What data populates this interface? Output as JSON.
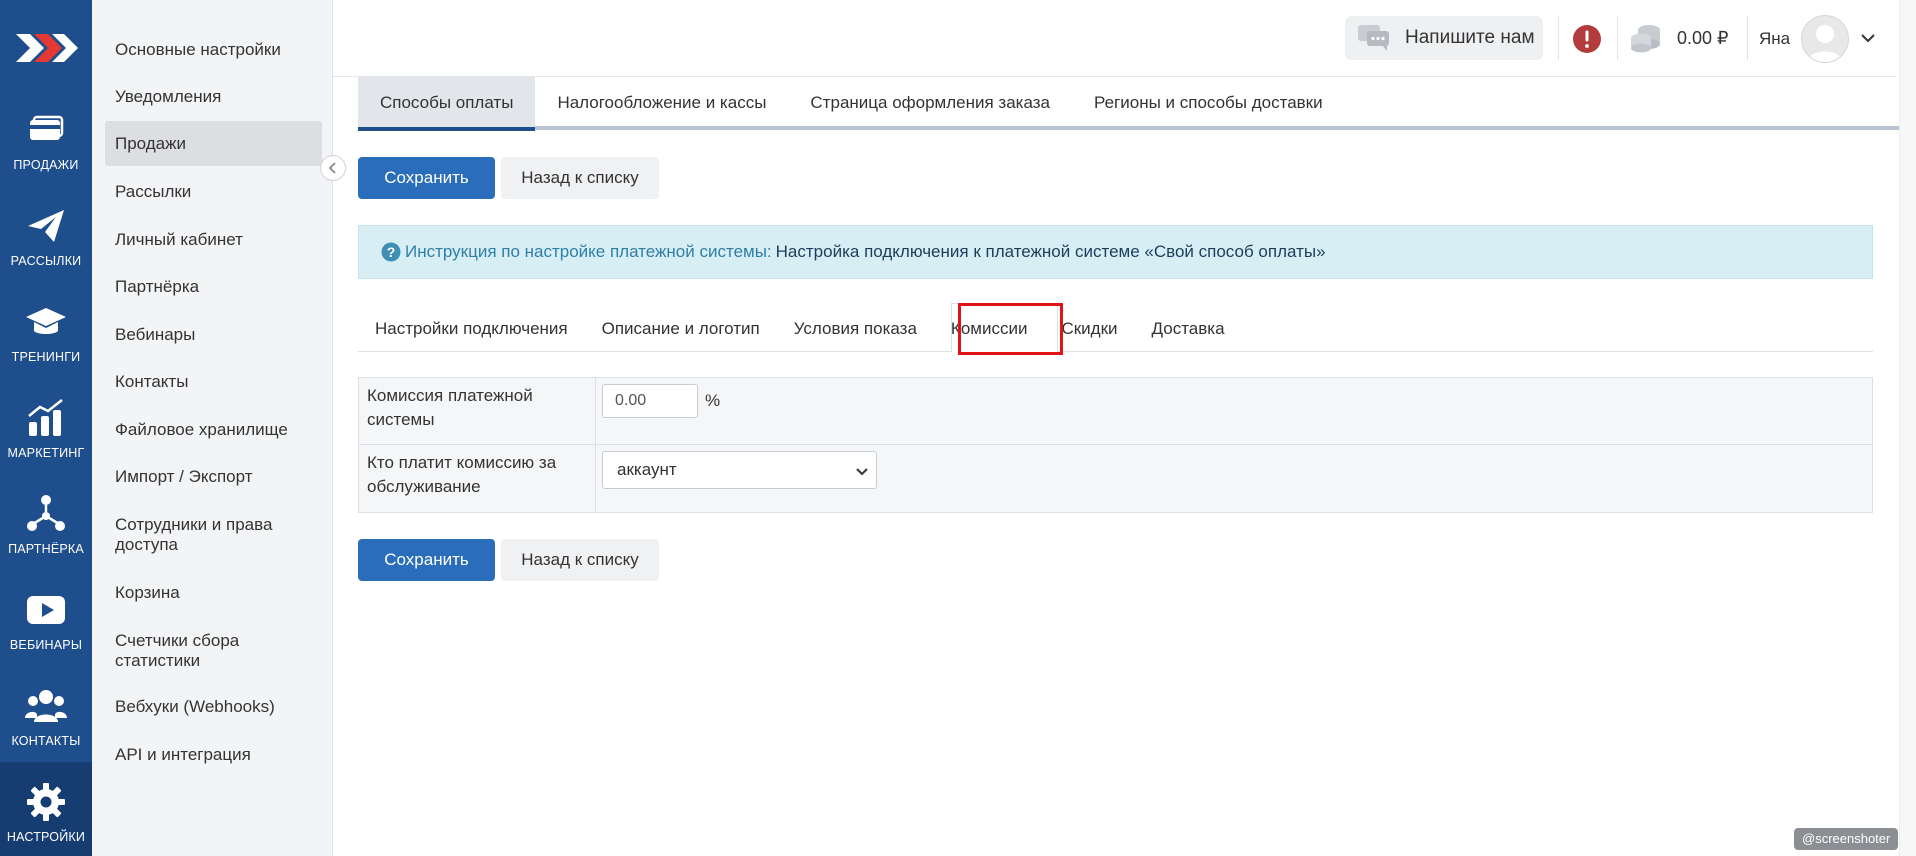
{
  "rail": {
    "items": [
      {
        "label": "Продажи",
        "icon": "card-icon"
      },
      {
        "label": "Рассылки",
        "icon": "paper-plane-icon"
      },
      {
        "label": "Тренинги",
        "icon": "graduation-cap-icon"
      },
      {
        "label": "Маркетинг",
        "icon": "chart-icon"
      },
      {
        "label": "Партнёрка",
        "icon": "network-icon"
      },
      {
        "label": "Вебинары",
        "icon": "play-icon"
      },
      {
        "label": "Контакты",
        "icon": "users-icon"
      },
      {
        "label": "Настройки",
        "icon": "gear-icon"
      }
    ]
  },
  "menu": {
    "items": [
      {
        "label": "Основные настройки"
      },
      {
        "label": "Уведомления"
      },
      {
        "label": "Продажи"
      },
      {
        "label": "Рассылки"
      },
      {
        "label": "Личный кабинет"
      },
      {
        "label": "Партнёрка"
      },
      {
        "label": "Вебинары"
      },
      {
        "label": "Контакты"
      },
      {
        "label": "Файловое хранилище"
      },
      {
        "label": "Импорт / Экспорт"
      },
      {
        "label": "Сотрудники и права доступа"
      },
      {
        "label": "Корзина"
      },
      {
        "label": "Счетчики сбора статистики"
      },
      {
        "label": "Вебхуки (Webhooks)"
      },
      {
        "label": "API и интеграция"
      }
    ]
  },
  "header": {
    "write_us": "Напишите нам",
    "balance": "0.00 ₽",
    "username": "Яна"
  },
  "main_tabs": [
    {
      "label": "Способы оплаты"
    },
    {
      "label": "Налогообложение и кассы"
    },
    {
      "label": "Страница оформления заказа"
    },
    {
      "label": "Регионы и способы доставки"
    }
  ],
  "actions": {
    "save": "Сохранить",
    "back": "Назад к списку"
  },
  "info": {
    "lead": "Инструкция по настройке платежной системы:",
    "link": "Настройка подключения к платежной системе «Свой способ оплаты»"
  },
  "inner_tabs": [
    {
      "label": "Настройки подключения"
    },
    {
      "label": "Описание и логотип"
    },
    {
      "label": "Условия показа"
    },
    {
      "label": "Комиссии"
    },
    {
      "label": "Скидки"
    },
    {
      "label": "Доставка"
    }
  ],
  "form": {
    "commission_label": "Комиссия платежной системы",
    "commission_value": "0.00",
    "commission_unit": "%",
    "payer_label": "Кто платит комиссию за обслуживание",
    "payer_value": "аккаунт"
  },
  "watermark": "@screenshoter",
  "colors": {
    "rail_bg": "#1f4e8c",
    "primary": "#2a6ebb",
    "info_bg": "#d8eef5",
    "highlight": "#e01414"
  }
}
